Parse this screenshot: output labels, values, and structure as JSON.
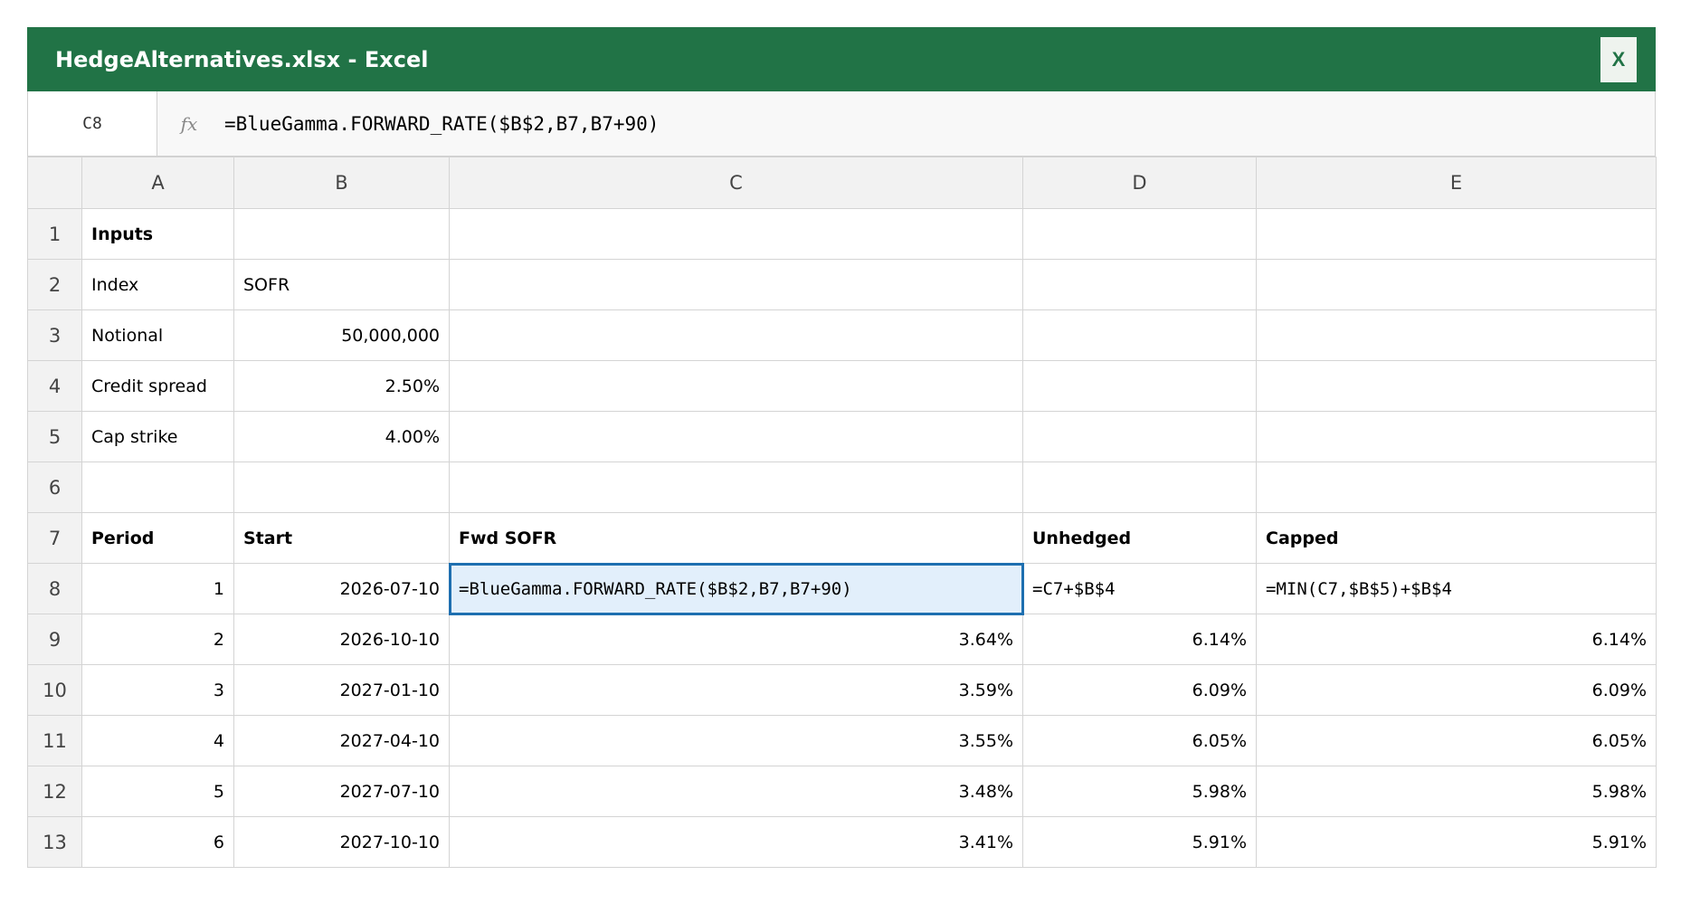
{
  "window": {
    "title": "HedgeAlternatives.xlsx - Excel",
    "close_label": "X",
    "accent": "#217346"
  },
  "formula_bar": {
    "cell_ref": "C8",
    "fx_label": "fx",
    "formula": "=BlueGamma.FORWARD_RATE($B$2,B7,B7+90)"
  },
  "columns": [
    "A",
    "B",
    "C",
    "D",
    "E"
  ],
  "rows": [
    {
      "num": "1",
      "A": "Inputs",
      "B": "",
      "C": "",
      "D": "",
      "E": ""
    },
    {
      "num": "2",
      "A": "Index",
      "B": "SOFR",
      "C": "",
      "D": "",
      "E": ""
    },
    {
      "num": "3",
      "A": "Notional",
      "B": "50,000,000",
      "C": "",
      "D": "",
      "E": ""
    },
    {
      "num": "4",
      "A": "Credit spread",
      "B": "2.50%",
      "C": "",
      "D": "",
      "E": ""
    },
    {
      "num": "5",
      "A": "Cap strike",
      "B": "4.00%",
      "C": "",
      "D": "",
      "E": ""
    },
    {
      "num": "6",
      "A": "",
      "B": "",
      "C": "",
      "D": "",
      "E": ""
    },
    {
      "num": "7",
      "A": "Period",
      "B": "Start",
      "C": "Fwd SOFR",
      "D": "Unhedged",
      "E": "Capped"
    },
    {
      "num": "8",
      "A": "1",
      "B": "2026-07-10",
      "C": "=BlueGamma.FORWARD_RATE($B$2,B7,B7+90)",
      "D": "=C7+$B$4",
      "E": "=MIN(C7,$B$5)+$B$4"
    },
    {
      "num": "9",
      "A": "2",
      "B": "2026-10-10",
      "C": "3.64%",
      "D": "6.14%",
      "E": "6.14%"
    },
    {
      "num": "10",
      "A": "3",
      "B": "2027-01-10",
      "C": "3.59%",
      "D": "6.09%",
      "E": "6.09%"
    },
    {
      "num": "11",
      "A": "4",
      "B": "2027-04-10",
      "C": "3.55%",
      "D": "6.05%",
      "E": "6.05%"
    },
    {
      "num": "12",
      "A": "5",
      "B": "2027-07-10",
      "C": "3.48%",
      "D": "5.98%",
      "E": "5.98%"
    },
    {
      "num": "13",
      "A": "6",
      "B": "2027-10-10",
      "C": "3.41%",
      "D": "5.91%",
      "E": "5.91%"
    }
  ]
}
